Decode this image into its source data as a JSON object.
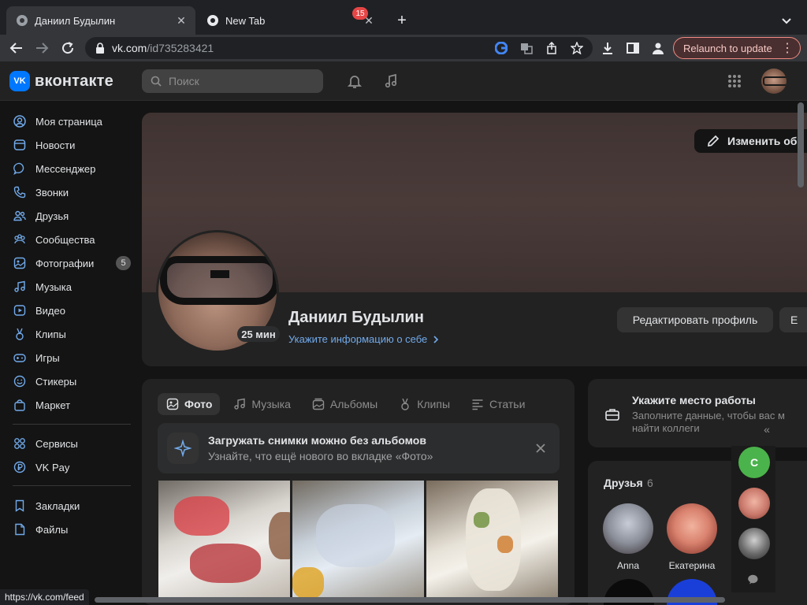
{
  "browser": {
    "tabs": [
      {
        "title": "Даниил Будылин",
        "active": true
      },
      {
        "title": "New Tab",
        "active": false
      }
    ],
    "new_tab_symbol": "+",
    "url_host": "vk.com",
    "url_path": "/id735283421",
    "relaunch_label": "Relaunch to update",
    "status_url": "https://vk.com/feed"
  },
  "vk_header": {
    "logo_badge": "VK",
    "logo_text": "вконтакте",
    "search_placeholder": "Поиск",
    "notifications_count": "15"
  },
  "sidebar": {
    "items": [
      {
        "label": "Моя страница",
        "icon": "user-circle-icon"
      },
      {
        "label": "Новости",
        "icon": "newspaper-icon"
      },
      {
        "label": "Мессенджер",
        "icon": "message-icon"
      },
      {
        "label": "Звонки",
        "icon": "phone-icon"
      },
      {
        "label": "Друзья",
        "icon": "friends-icon"
      },
      {
        "label": "Сообщества",
        "icon": "communities-icon"
      },
      {
        "label": "Фотографии",
        "icon": "photo-icon",
        "count": "5"
      },
      {
        "label": "Музыка",
        "icon": "music-icon"
      },
      {
        "label": "Видео",
        "icon": "video-icon"
      },
      {
        "label": "Клипы",
        "icon": "clips-icon"
      },
      {
        "label": "Игры",
        "icon": "gamepad-icon"
      },
      {
        "label": "Стикеры",
        "icon": "smile-icon"
      },
      {
        "label": "Маркет",
        "icon": "bag-icon"
      }
    ],
    "items2": [
      {
        "label": "Сервисы",
        "icon": "services-icon"
      },
      {
        "label": "VK Pay",
        "icon": "ruble-icon"
      }
    ],
    "items3": [
      {
        "label": "Закладки",
        "icon": "bookmark-icon"
      },
      {
        "label": "Файлы",
        "icon": "file-icon"
      }
    ]
  },
  "profile": {
    "edit_cover_label": "Изменить об",
    "online_label": "25 мин",
    "name": "Даниил Будылин",
    "info_link": "Укажите информацию о себе",
    "edit_profile_label": "Редактировать профиль",
    "more_label": "Е"
  },
  "photos_card": {
    "tabs": [
      {
        "label": "Фото",
        "icon": "photo-icon",
        "active": true
      },
      {
        "label": "Музыка",
        "icon": "music-icon",
        "active": false
      },
      {
        "label": "Альбомы",
        "icon": "albums-icon",
        "active": false
      },
      {
        "label": "Клипы",
        "icon": "clips-icon",
        "active": false
      },
      {
        "label": "Статьи",
        "icon": "article-icon",
        "active": false
      }
    ],
    "banner_title": "Загружать снимки можно без альбомов",
    "banner_sub": "Узнайте, что ещё нового во вкладке «Фото»"
  },
  "work_card": {
    "title": "Укажите место работы",
    "sub": "Заполните данные, чтобы вас м найти коллеги"
  },
  "friends_card": {
    "title": "Друзья",
    "count": "6",
    "friends": [
      {
        "name": "Anna"
      },
      {
        "name": "Екатерина"
      }
    ]
  },
  "chats": {
    "collapse_symbol": "«",
    "first_initial": "С"
  },
  "colors": {
    "accent": "#0077ff",
    "link": "#71aaeb",
    "badge_red": "#e64646",
    "online_green": "#4bb34b",
    "relaunch_border": "#f28b82"
  }
}
